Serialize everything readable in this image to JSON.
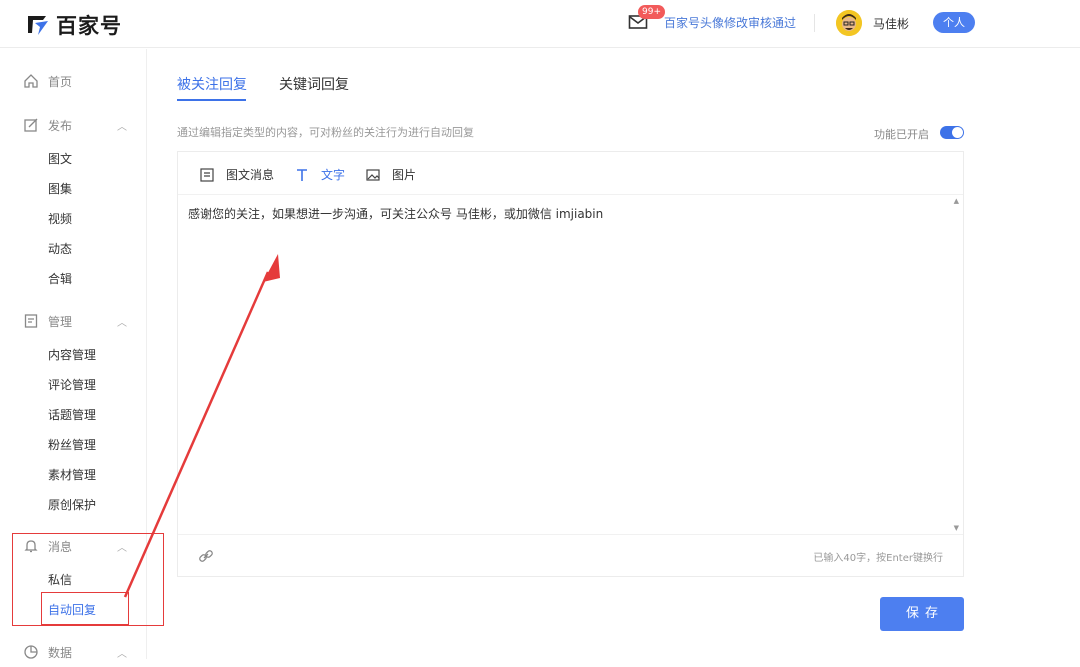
{
  "header": {
    "logo_text": "百家号",
    "notification_badge": "99+",
    "notification_text": "百家号头像修改审核通过",
    "username": "马佳彬",
    "account_type": "个人"
  },
  "sidebar": {
    "home": "首页",
    "publish": {
      "label": "发布",
      "items": [
        "图文",
        "图集",
        "视频",
        "动态",
        "合辑"
      ]
    },
    "manage": {
      "label": "管理",
      "items": [
        "内容管理",
        "评论管理",
        "话题管理",
        "粉丝管理",
        "素材管理",
        "原创保护"
      ]
    },
    "message": {
      "label": "消息",
      "items": [
        "私信",
        "自动回复"
      ]
    },
    "data": {
      "label": "数据"
    }
  },
  "main": {
    "tabs": [
      "被关注回复",
      "关键词回复"
    ],
    "active_tab": "被关注回复",
    "description": "通过编辑指定类型的内容，可对粉丝的关注行为进行自动回复",
    "toggle_label": "功能已开启",
    "toggle_on": true,
    "types": [
      "图文消息",
      "文字",
      "图片"
    ],
    "active_type": "文字",
    "reply_text": "感谢您的关注，如果想进一步沟通，可关注公众号 马佳彬，或加微信 imjiabin",
    "char_count": "已输入40字，按Enter键换行",
    "save_label": "保存"
  },
  "colors": {
    "accent": "#3d72e8",
    "annotation": "#e53b3b"
  }
}
